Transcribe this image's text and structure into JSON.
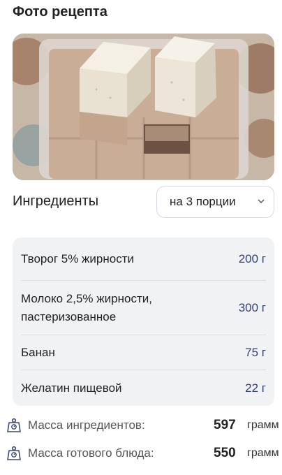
{
  "photo_section": {
    "title": "Фото рецепта"
  },
  "ingredients_section": {
    "title": "Ингредиенты",
    "portion_select": {
      "selected": "на 3 порции"
    },
    "items": [
      {
        "name": "Творог 5% жирности",
        "amount": "200 г"
      },
      {
        "name": "Молоко 2,5% жирности,\nпастеризованное",
        "amount": "300 г"
      },
      {
        "name": "Банан",
        "amount": "75 г"
      },
      {
        "name": "Желатин пищевой",
        "amount": "22 г"
      }
    ]
  },
  "mass": {
    "ingredients": {
      "label": "Масса ингредиентов:",
      "value": "597",
      "unit": "грамм"
    },
    "dish": {
      "label": "Масса готового блюда:",
      "value": "550",
      "unit": "грамм"
    }
  },
  "colors": {
    "accent_amount": "#32437a",
    "card_bg": "#f1f2f4"
  },
  "icons": {
    "scale": "scale-icon",
    "select_chevron": "chevron-down-icon"
  }
}
